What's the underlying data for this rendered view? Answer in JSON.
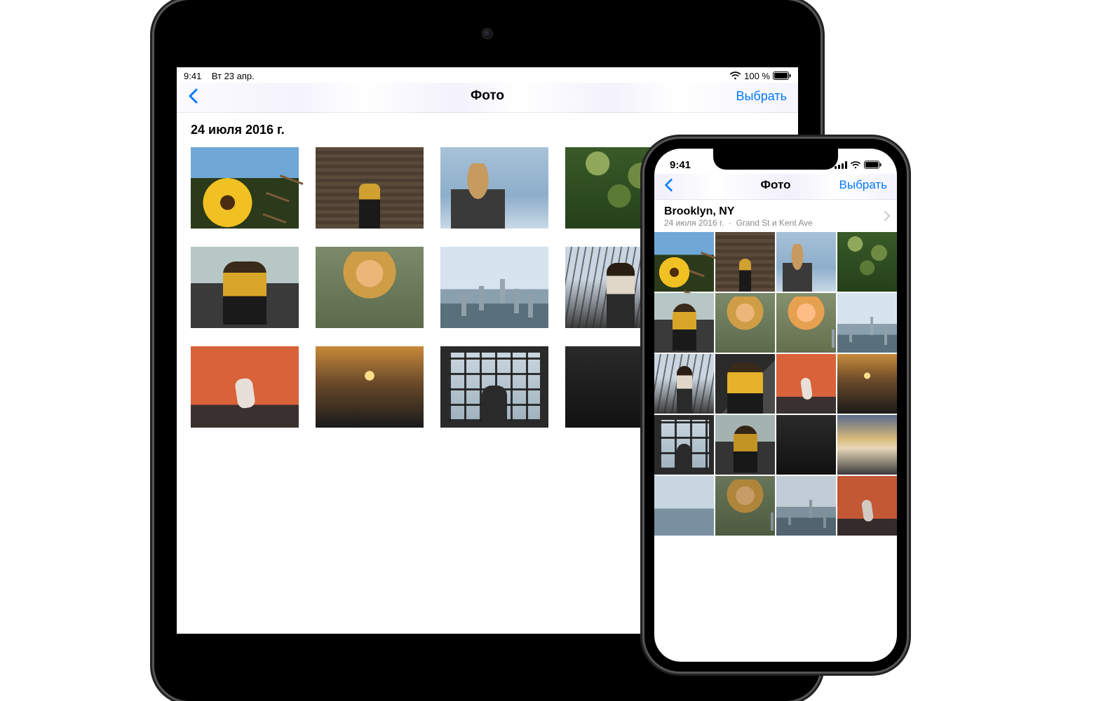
{
  "ipad": {
    "status": {
      "time": "9:41",
      "date": "Вт 23 апр.",
      "battery": "100 %"
    },
    "nav": {
      "title": "Фото",
      "select": "Выбрать"
    },
    "section_date": "24 июля 2016 г."
  },
  "iphone": {
    "status": {
      "time": "9:41"
    },
    "nav": {
      "title": "Фото",
      "select": "Выбрать"
    },
    "section": {
      "location": "Brooklyn, NY",
      "date": "24 июля 2016 г.",
      "separator": "·",
      "streets": "Grand St и Kent Ave"
    }
  }
}
